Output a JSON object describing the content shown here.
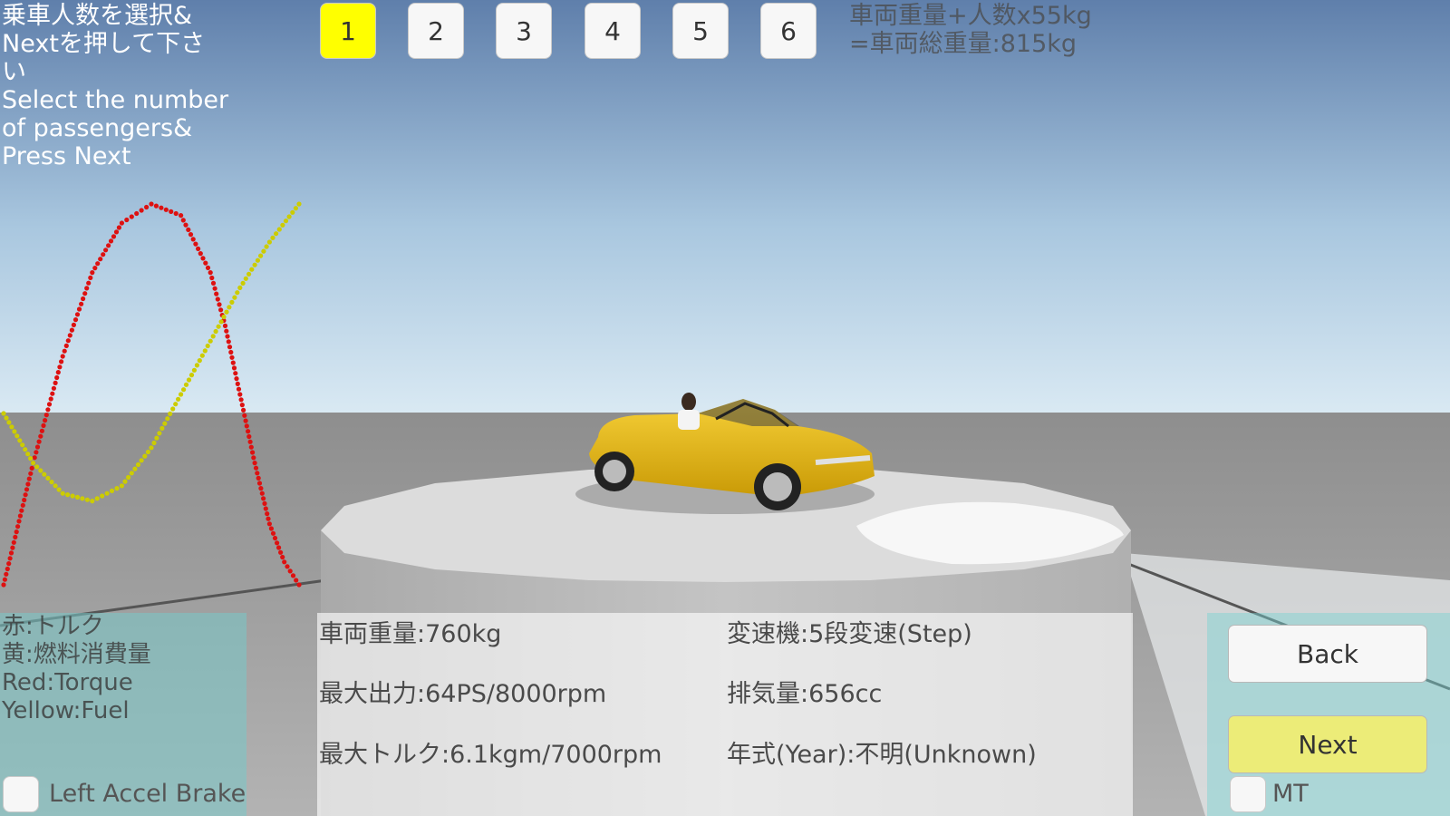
{
  "instruction": {
    "lines": [
      "乗車人数を選択&",
      "Nextを押して下さ",
      "い",
      "Select the number",
      "of passengers&",
      "Press Next"
    ]
  },
  "passengers": {
    "options": [
      "1",
      "2",
      "3",
      "4",
      "5",
      "6"
    ],
    "selected": "1"
  },
  "weight_info": {
    "line1": "車両重量+人数x55kg",
    "line2": "=車両総重量:815kg"
  },
  "legend": {
    "lines": [
      "赤:トルク",
      "黄:燃料消費量",
      "Red:Torque",
      "Yellow:Fuel"
    ]
  },
  "specs": {
    "weight": "車両重量:760kg",
    "power": "最大出力:64PS/8000rpm",
    "torque": "最大トルク:6.1kgm/7000rpm",
    "transmission": "変速機:5段変速(Step)",
    "displacement": "排気量:656cc",
    "year": "年式(Year):不明(Unknown)"
  },
  "controls": {
    "left_accel_brake_label": "Left Accel Brake",
    "back_label": "Back",
    "next_label": "Next",
    "mt_label": "MT"
  },
  "colors": {
    "selected_button": "#ffff00",
    "next_button": "#ecec78",
    "torque_curve": "#dd1111",
    "fuel_curve": "#cccc00",
    "car_body": "#e8b810"
  },
  "chart_data": {
    "type": "line",
    "title": "",
    "xlabel": "",
    "ylabel": "",
    "grid": false,
    "legend": "bottom-left text",
    "series": [
      {
        "name": "Red:Torque",
        "color": "#dd1111",
        "x": [
          0,
          0.1,
          0.2,
          0.3,
          0.4,
          0.5,
          0.6,
          0.7,
          0.75,
          0.8,
          0.85,
          0.9,
          0.95,
          1.0
        ],
        "y": [
          0,
          0.32,
          0.6,
          0.82,
          0.95,
          1.0,
          0.97,
          0.82,
          0.68,
          0.5,
          0.32,
          0.16,
          0.06,
          0.0
        ]
      },
      {
        "name": "Yellow:Fuel",
        "color": "#cccc00",
        "x": [
          0,
          0.1,
          0.2,
          0.3,
          0.4,
          0.5,
          0.6,
          0.7,
          0.8,
          0.9,
          1.0
        ],
        "y": [
          0.45,
          0.32,
          0.24,
          0.22,
          0.26,
          0.36,
          0.5,
          0.64,
          0.78,
          0.9,
          1.0
        ]
      }
    ]
  }
}
